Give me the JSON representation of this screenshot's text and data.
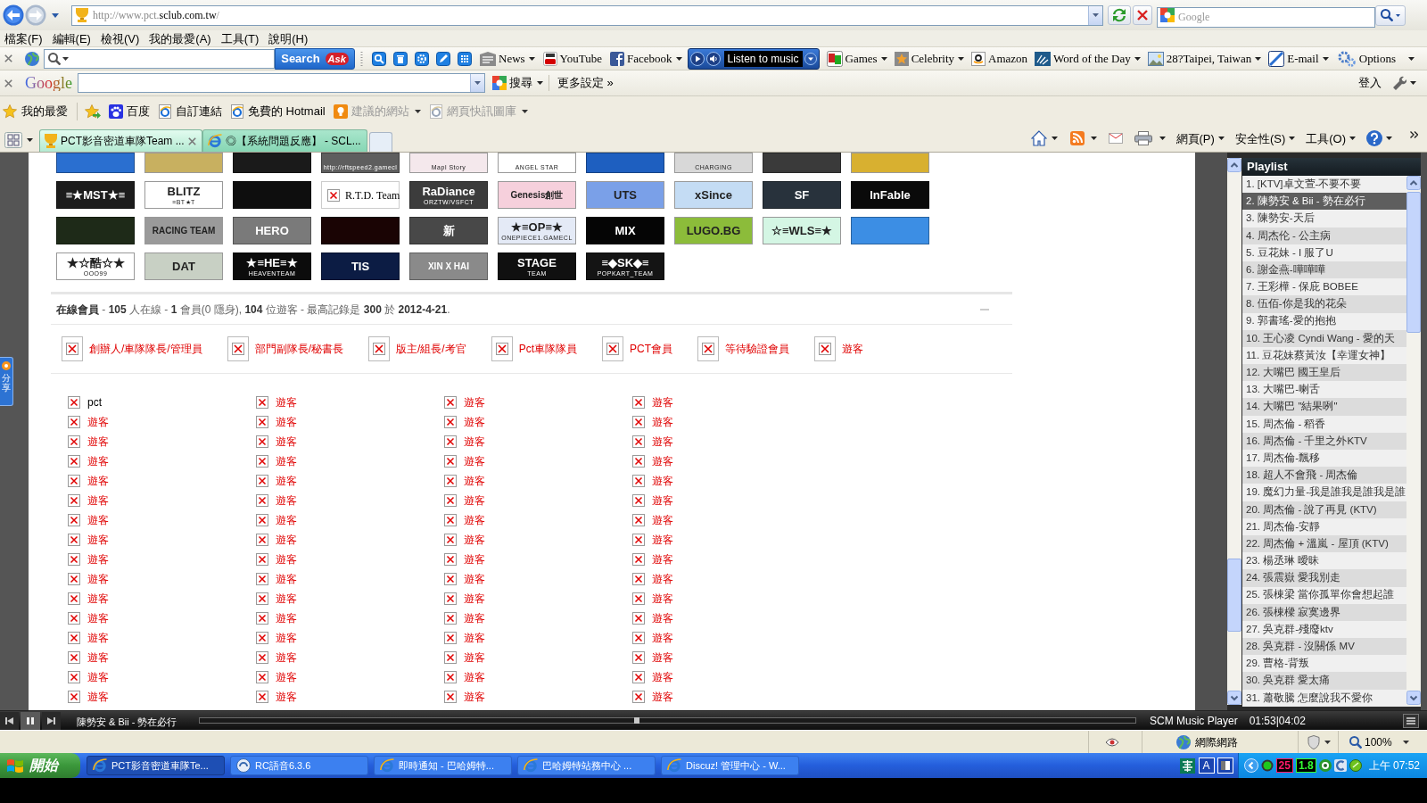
{
  "address_bar": {
    "url": "http://www.pct.**sclub.com.tw**/",
    "search": {
      "placeholder": "Google"
    }
  },
  "menu_bar": [
    "檔案(F)",
    "編輯(E)",
    "檢視(V)",
    "我的最愛(A)",
    "工具(T)",
    "說明(H)"
  ],
  "ask_toolbar": {
    "search_button": "Search",
    "search_logo": "Ask",
    "links": [
      {
        "label": "News",
        "dropdown": true
      },
      {
        "label": "YouTube",
        "dropdown": false
      },
      {
        "label": "Facebook",
        "dropdown": true
      }
    ],
    "music_button": "Listen to music",
    "more_links": [
      {
        "label": "Games",
        "dropdown": true
      },
      {
        "label": "Celebrity",
        "dropdown": true
      },
      {
        "label": "Amazon",
        "dropdown": false
      },
      {
        "label": "Word of the Day",
        "dropdown": true
      },
      {
        "label": "28?Taipei, Taiwan",
        "dropdown": true
      },
      {
        "label": "E-mail",
        "dropdown": true
      }
    ],
    "options": "Options"
  },
  "google_toolbar": {
    "logo": "Google",
    "search_button": "搜尋",
    "more_settings": "更多設定 »",
    "sign_in": "登入"
  },
  "favorites_bar": {
    "title": "我的最愛",
    "links": [
      {
        "label": "百度",
        "disabled": false,
        "dropdown": false
      },
      {
        "label": "自訂連結",
        "disabled": false,
        "dropdown": false
      },
      {
        "label": "免費的 Hotmail",
        "disabled": false,
        "dropdown": false
      },
      {
        "label": "建議的網站",
        "disabled": true,
        "dropdown": true
      },
      {
        "label": "網頁快訊圖庫",
        "disabled": true,
        "dropdown": true
      }
    ]
  },
  "tabs": [
    {
      "label": "PCT影音密道車隊Team ...",
      "selected": true
    },
    {
      "label": "◎【系統問題反應】 - SCL...",
      "selected": false
    }
  ],
  "command_bar": [
    "網頁(P)",
    "安全性(S)",
    "工具(O)"
  ],
  "page": {
    "share_tab": "分享",
    "banner_rows": [
      [
        {
          "kind": "image",
          "color": "#2a6fd0"
        },
        {
          "kind": "image",
          "color": "#c8b060"
        },
        {
          "kind": "image",
          "color": "#1a1a1a"
        },
        {
          "kind": "image",
          "color": "#5e5e5e",
          "sub": "http://rftspeed2.gamecl"
        },
        {
          "kind": "image",
          "color": "#f4e8ec",
          "sub": "Mapl Story"
        },
        {
          "kind": "image",
          "color": "#ffffff",
          "sub": "ANGEL STAR"
        },
        {
          "kind": "image",
          "color": "#1e5fc0"
        },
        {
          "kind": "image",
          "color": "#d8d8d8",
          "sub": "CHARGING"
        },
        {
          "kind": "image",
          "color": "#3a3a3a"
        },
        {
          "kind": "image",
          "color": "#d8b030"
        }
      ],
      [
        {
          "kind": "image",
          "color": "#1c1c1c",
          "label": "≡★MST★≡"
        },
        {
          "kind": "image",
          "color": "#ffffff",
          "label": "BLITZ",
          "sub": "≡BT★T"
        },
        {
          "kind": "image",
          "color": "#0e0e0e"
        },
        {
          "kind": "broken",
          "label": "R.T.D. Team"
        },
        {
          "kind": "image",
          "color": "#3c3c3c",
          "label": "RaDiance",
          "sub": "ORZTW/VSFCT"
        },
        {
          "kind": "image",
          "color": "#f6d0dc",
          "label": "Genesis創世"
        },
        {
          "kind": "image",
          "color": "#7aa0e8",
          "label": "UTS"
        },
        {
          "kind": "image",
          "color": "#c4dcf4",
          "label": "xSince"
        },
        {
          "kind": "image",
          "color": "#28323c",
          "label": "SF"
        },
        {
          "kind": "image",
          "color": "#0a0a0a",
          "label": "InFable"
        }
      ],
      [
        {
          "kind": "image",
          "color": "#1e2a18"
        },
        {
          "kind": "image",
          "color": "#9a9a9a",
          "label": "RACING TEAM"
        },
        {
          "kind": "image",
          "color": "#7a7a7a",
          "label": "HERO"
        },
        {
          "kind": "image",
          "color": "#1a0404"
        },
        {
          "kind": "image",
          "color": "#484848",
          "label": "新"
        },
        {
          "kind": "image",
          "color": "#e4eaf6",
          "label": "★≡OP≡★",
          "sub": "ONEPIECE1.GAMECL"
        },
        {
          "kind": "image",
          "color": "#050505",
          "label": "MIX"
        },
        {
          "kind": "image",
          "color": "#8cbc3a",
          "label": "LUGO.BG"
        },
        {
          "kind": "image",
          "color": "#d4f6e4",
          "label": "☆≡WLS≡★"
        },
        {
          "kind": "image",
          "color": "#3c8ee4"
        }
      ],
      [
        {
          "kind": "image",
          "color": "#ffffff",
          "label": "★☆酷☆★",
          "sub": "OOO99"
        },
        {
          "kind": "image",
          "color": "#c8d0c4",
          "label": "DAT"
        },
        {
          "kind": "image",
          "color": "#0c0c0c",
          "label": "★≡HE≡★",
          "sub": "HEAVENTEAM"
        },
        {
          "kind": "image",
          "color": "#0c1c44",
          "label": "TIS"
        },
        {
          "kind": "image",
          "color": "#8a8a8a",
          "label": "XIN X HAI"
        },
        {
          "kind": "image",
          "color": "#101010",
          "label": "STAGE",
          "sub": "TEAM"
        },
        {
          "kind": "image",
          "color": "#141414",
          "label": "≡◆SK◆≡",
          "sub": "POPKART_TEAM"
        }
      ]
    ],
    "online": {
      "summary": "**在線會員** - **105** 人在線 - **1** 會員(0 隱身), **104** 位遊客 - 最高記錄是 **300** 於 **2012-4-21**.",
      "legend": [
        "創辦人/車隊隊長/管理員",
        "部門副隊長/秘書長",
        "版主/組長/考官",
        "Pct車隊隊員",
        "PCT會員",
        "等待驗證會員",
        "遊客"
      ],
      "members": [
        {
          "name": "pct",
          "kind": "member"
        },
        {
          "name": "遊客",
          "kind": "guest"
        },
        {
          "name": "遊客",
          "kind": "guest"
        },
        {
          "name": "遊客",
          "kind": "guest"
        },
        {
          "name": "遊客",
          "kind": "guest"
        },
        {
          "name": "遊客",
          "kind": "guest"
        },
        {
          "name": "遊客",
          "kind": "guest"
        },
        {
          "name": "遊客",
          "kind": "guest"
        },
        {
          "name": "遊客",
          "kind": "guest"
        },
        {
          "name": "遊客",
          "kind": "guest"
        },
        {
          "name": "遊客",
          "kind": "guest"
        },
        {
          "name": "遊客",
          "kind": "guest"
        },
        {
          "name": "遊客",
          "kind": "guest"
        },
        {
          "name": "遊客",
          "kind": "guest"
        },
        {
          "name": "遊客",
          "kind": "guest"
        },
        {
          "name": "遊客",
          "kind": "guest"
        },
        {
          "name": "遊客",
          "kind": "guest"
        },
        {
          "name": "遊客",
          "kind": "guest"
        },
        {
          "name": "遊客",
          "kind": "guest"
        },
        {
          "name": "遊客",
          "kind": "guest"
        },
        {
          "name": "遊客",
          "kind": "guest"
        },
        {
          "name": "遊客",
          "kind": "guest"
        },
        {
          "name": "遊客",
          "kind": "guest"
        },
        {
          "name": "遊客",
          "kind": "guest"
        },
        {
          "name": "遊客",
          "kind": "guest"
        },
        {
          "name": "遊客",
          "kind": "guest"
        },
        {
          "name": "遊客",
          "kind": "guest"
        },
        {
          "name": "遊客",
          "kind": "guest"
        },
        {
          "name": "遊客",
          "kind": "guest"
        },
        {
          "name": "遊客",
          "kind": "guest"
        },
        {
          "name": "遊客",
          "kind": "guest"
        },
        {
          "name": "遊客",
          "kind": "guest"
        },
        {
          "name": "遊客",
          "kind": "guest"
        },
        {
          "name": "遊客",
          "kind": "guest"
        },
        {
          "name": "遊客",
          "kind": "guest"
        },
        {
          "name": "遊客",
          "kind": "guest"
        },
        {
          "name": "遊客",
          "kind": "guest"
        },
        {
          "name": "遊客",
          "kind": "guest"
        },
        {
          "name": "遊客",
          "kind": "guest"
        },
        {
          "name": "遊客",
          "kind": "guest"
        },
        {
          "name": "遊客",
          "kind": "guest"
        },
        {
          "name": "遊客",
          "kind": "guest"
        },
        {
          "name": "遊客",
          "kind": "guest"
        },
        {
          "name": "遊客",
          "kind": "guest"
        },
        {
          "name": "遊客",
          "kind": "guest"
        },
        {
          "name": "遊客",
          "kind": "guest"
        },
        {
          "name": "遊客",
          "kind": "guest"
        },
        {
          "name": "遊客",
          "kind": "guest"
        },
        {
          "name": "遊客",
          "kind": "guest"
        },
        {
          "name": "遊客",
          "kind": "guest"
        },
        {
          "name": "遊客",
          "kind": "guest"
        },
        {
          "name": "遊客",
          "kind": "guest"
        },
        {
          "name": "遊客",
          "kind": "guest"
        },
        {
          "name": "遊客",
          "kind": "guest"
        },
        {
          "name": "遊客",
          "kind": "guest"
        },
        {
          "name": "遊客",
          "kind": "guest"
        },
        {
          "name": "遊客",
          "kind": "guest"
        },
        {
          "name": "遊客",
          "kind": "guest"
        },
        {
          "name": "遊客",
          "kind": "guest"
        },
        {
          "name": "遊客",
          "kind": "guest"
        },
        {
          "name": "遊客",
          "kind": "guest"
        },
        {
          "name": "遊客",
          "kind": "guest"
        },
        {
          "name": "遊客",
          "kind": "guest"
        },
        {
          "name": "遊客",
          "kind": "guest"
        }
      ]
    }
  },
  "playlist": {
    "title": "Playlist",
    "tracks": [
      {
        "title": "1. [KTV]卓文萱-不要不要",
        "selected": false
      },
      {
        "title": "2. 陳勢安 & Bii - 勢在必行",
        "selected": true
      },
      {
        "title": "3. 陳勢安-天后",
        "selected": false
      },
      {
        "title": "4. 周杰伦 - 公主病",
        "selected": false
      },
      {
        "title": "5. 豆花妹 - I 服了U",
        "selected": false
      },
      {
        "title": "6. 謝金燕-嘩嘩嘩",
        "selected": false
      },
      {
        "title": "7. 王彩樺 - 保庇 BOBEE",
        "selected": false
      },
      {
        "title": "8. 伍佰-你是我的花朵",
        "selected": false
      },
      {
        "title": "9. 郭書瑤-愛的抱抱",
        "selected": false
      },
      {
        "title": "10. 王心凌 Cyndi Wang - 愛的天",
        "selected": false
      },
      {
        "title": "11. 豆花妹蔡黃汝【幸運女神】",
        "selected": false
      },
      {
        "title": "12. 大嘴巴 國王皇后",
        "selected": false
      },
      {
        "title": "13. 大嘴巴-喇舌",
        "selected": false
      },
      {
        "title": "14. 大嘴巴 \"結果咧\"",
        "selected": false
      },
      {
        "title": "15. 周杰倫 - 稻香",
        "selected": false
      },
      {
        "title": "16. 周杰倫 - 千里之外KTV",
        "selected": false
      },
      {
        "title": "17. 周杰倫-飄移",
        "selected": false
      },
      {
        "title": "18. 超人不會飛 - 周杰倫",
        "selected": false
      },
      {
        "title": "19. 魔幻力量-我是誰我是誰我是誰",
        "selected": false
      },
      {
        "title": "20. 周杰倫 - 說了再見 (KTV)",
        "selected": false
      },
      {
        "title": "21. 周杰倫-安靜",
        "selected": false
      },
      {
        "title": "22. 周杰倫 + 溫嵐 - 屋頂 (KTV)",
        "selected": false
      },
      {
        "title": "23. 楊丞琳 曖昧",
        "selected": false
      },
      {
        "title": "24. 張震嶽 愛我別走",
        "selected": false
      },
      {
        "title": "25. 張棟梁 當你孤單你會想起誰",
        "selected": false
      },
      {
        "title": "26. 張棟樑 寂寞邊界",
        "selected": false
      },
      {
        "title": "27. 吳克群-殘廢ktv",
        "selected": false
      },
      {
        "title": "28. 吳克群 - 沒關係 MV",
        "selected": false
      },
      {
        "title": "29. 曹格-背叛",
        "selected": false
      },
      {
        "title": "30. 吳克群 愛太痛",
        "selected": false
      },
      {
        "title": "31. 蕭敬騰 怎麼說我不愛你",
        "selected": false
      }
    ]
  },
  "player": {
    "now_playing": "陳勢安 & Bii - 勢在必行",
    "playing": true,
    "level": 0.467,
    "title": "SCM Music Player",
    "time": "01:53|04:02"
  },
  "status_bar": {
    "zone": "網際網路",
    "zoom": "100%"
  },
  "taskbar": {
    "start": "開始",
    "tasks": [
      {
        "label": "PCT影音密道車隊Te...",
        "selected": true
      },
      {
        "label": "RC語音6.3.6",
        "selected": false
      },
      {
        "label": "即時通知 - 巴哈姆特...",
        "selected": false
      },
      {
        "label": "巴哈姆特站務中心 ...",
        "selected": false
      },
      {
        "label": "Discuz! 管理中心 - W...",
        "selected": false
      }
    ],
    "ime_mode": "A",
    "tray_badges": [
      {
        "text": "25",
        "color": "#ff1a6a"
      },
      {
        "text": "1.8",
        "color": "#33ff33"
      }
    ],
    "clock": "上午 07:52"
  }
}
